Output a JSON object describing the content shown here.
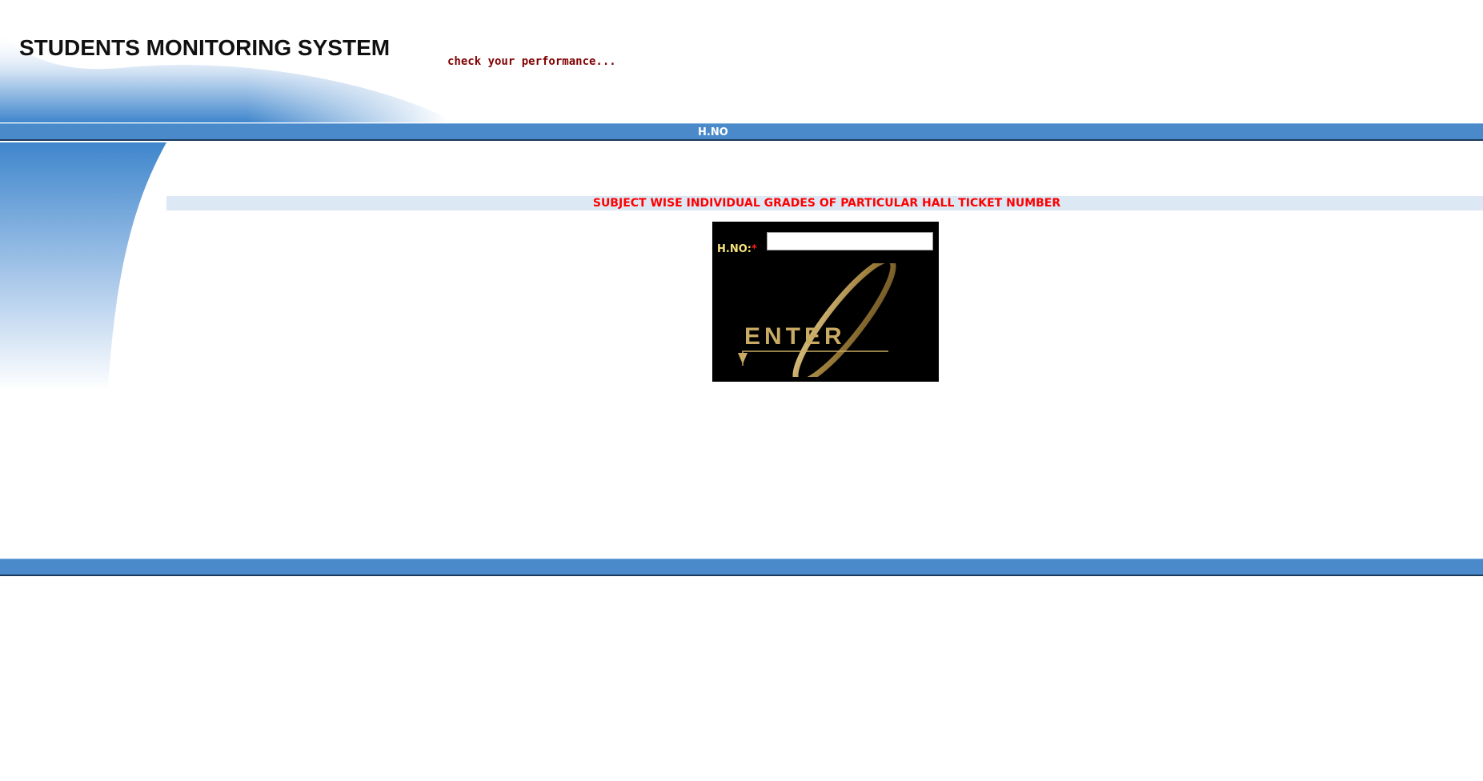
{
  "header": {
    "title": "STUDENTS MONITORING SYSTEM",
    "tagline": "check your performance..."
  },
  "nav_bar": {
    "label": "H.NO"
  },
  "main": {
    "subheading": "SUBJECT WISE INDIVIDUAL GRADES OF PARTICULAR HALL TICKET NUMBER",
    "form": {
      "hno_label": "H.NO:",
      "required_marker": "*",
      "hno_value": "",
      "enter_label": "ENTER"
    }
  },
  "colors": {
    "bar_blue": "#4a8acb",
    "subheading_red": "#ff0000",
    "tagline_maroon": "#800000",
    "form_bg": "#000000",
    "enter_gold": "#c8aa63",
    "label_yellow": "#f5e27a"
  },
  "icons": {
    "enter": "enter-arrow-swoosh-icon"
  }
}
